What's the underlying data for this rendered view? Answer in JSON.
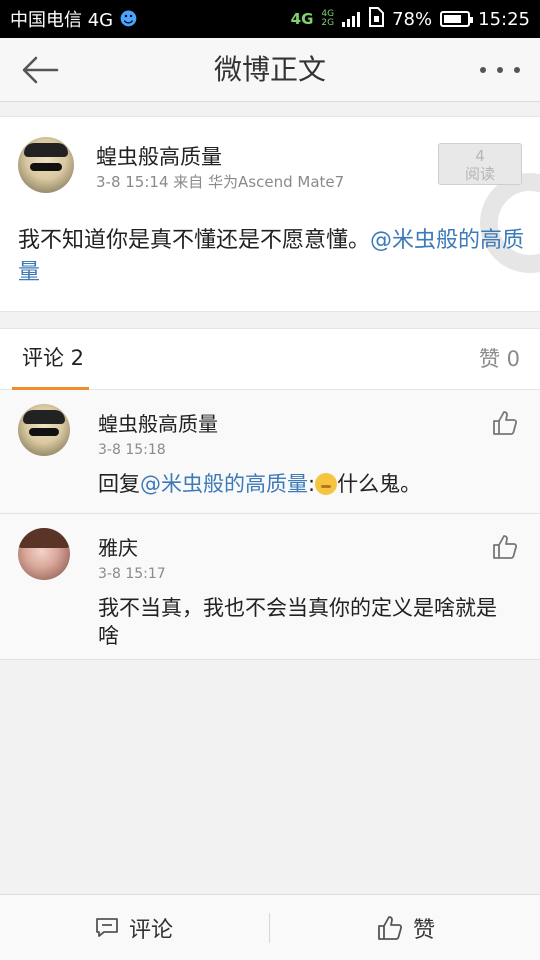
{
  "status_bar": {
    "carrier": "中国电信 4G",
    "network_4g": "4G",
    "network_small_4g": "4G",
    "network_small_2g": "2G",
    "battery_percent": "78%",
    "battery_level": 0.78,
    "time": "15:25"
  },
  "header": {
    "title": "微博正文"
  },
  "post": {
    "author": "蝗虫般高质量",
    "meta": "3-8 15:14  来自 华为Ascend Mate7",
    "read_count": "4",
    "read_label": "阅读",
    "text": "我不知道你是真不懂还是不愿意懂。",
    "mention": "@米虫般的高质量"
  },
  "tabs": {
    "comment_label": "评论 2",
    "like_label": "赞 0"
  },
  "comments": [
    {
      "name": "蝗虫般高质量",
      "time": "3-8 15:18",
      "prefix": "回复",
      "mention": "@米虫般的高质量",
      "colon": ":",
      "text": "什么鬼。"
    },
    {
      "name": "雅庆",
      "time": "3-8 15:17",
      "text": "我不当真，我也不会当真你的定义是啥就是啥"
    }
  ],
  "bottom_bar": {
    "comment_label": "评论",
    "like_label": "赞"
  },
  "icons": {
    "back": "back-arrow-icon",
    "more": "more-dots-icon",
    "thumb": "thumb-up-icon",
    "comment": "comment-bubble-icon"
  },
  "colors": {
    "accent_tab": "#f08c2c",
    "mention": "#3d7ab8"
  }
}
